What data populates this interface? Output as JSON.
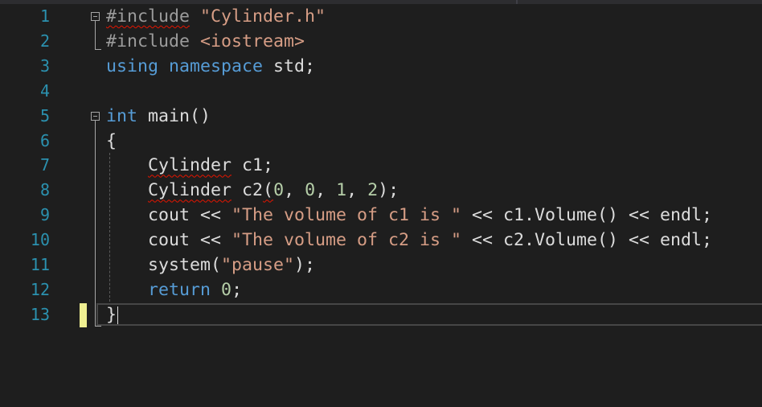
{
  "editor": {
    "colors": {
      "line_number": "#2b91af",
      "preprocessor": "#9b9b9b",
      "string": "#d69d85",
      "keyword": "#569cd6",
      "number": "#b5cea8",
      "text": "#dcdcdc"
    },
    "lines": [
      {
        "number": "1",
        "tokens": [
          {
            "t": "pp",
            "v": "#include",
            "err": true
          },
          {
            "t": "txt",
            "v": " "
          },
          {
            "t": "str",
            "v": "\"Cylinder.h\""
          }
        ]
      },
      {
        "number": "2",
        "tokens": [
          {
            "t": "pp",
            "v": "#include"
          },
          {
            "t": "txt",
            "v": " "
          },
          {
            "t": "str",
            "v": "<iostream>"
          }
        ]
      },
      {
        "number": "3",
        "tokens": [
          {
            "t": "kw",
            "v": "using"
          },
          {
            "t": "txt",
            "v": " "
          },
          {
            "t": "kw",
            "v": "namespace"
          },
          {
            "t": "txt",
            "v": " std;"
          }
        ]
      },
      {
        "number": "4",
        "tokens": []
      },
      {
        "number": "5",
        "tokens": [
          {
            "t": "kw",
            "v": "int"
          },
          {
            "t": "txt",
            "v": " main()"
          }
        ]
      },
      {
        "number": "6",
        "tokens": [
          {
            "t": "txt",
            "v": "{"
          }
        ]
      },
      {
        "number": "7",
        "tokens": [
          {
            "t": "txt",
            "v": "    "
          },
          {
            "t": "txt",
            "v": "Cylinder",
            "err": true
          },
          {
            "t": "txt",
            "v": " c1;"
          }
        ]
      },
      {
        "number": "8",
        "tokens": [
          {
            "t": "txt",
            "v": "    "
          },
          {
            "t": "txt",
            "v": "Cylinder",
            "err": true
          },
          {
            "t": "txt",
            "v": " c2"
          },
          {
            "t": "txt",
            "v": "(",
            "err": true
          },
          {
            "t": "num",
            "v": "0"
          },
          {
            "t": "txt",
            "v": ", "
          },
          {
            "t": "num",
            "v": "0"
          },
          {
            "t": "txt",
            "v": ", "
          },
          {
            "t": "num",
            "v": "1"
          },
          {
            "t": "txt",
            "v": ", "
          },
          {
            "t": "num",
            "v": "2"
          },
          {
            "t": "txt",
            "v": ");"
          }
        ]
      },
      {
        "number": "9",
        "tokens": [
          {
            "t": "txt",
            "v": "    cout << "
          },
          {
            "t": "str",
            "v": "\"The volume of c1 is \""
          },
          {
            "t": "txt",
            "v": " << c1.Volume() << endl;"
          }
        ]
      },
      {
        "number": "10",
        "tokens": [
          {
            "t": "txt",
            "v": "    cout << "
          },
          {
            "t": "str",
            "v": "\"The volume of c2 is \""
          },
          {
            "t": "txt",
            "v": " << c2.Volume() << endl;"
          }
        ]
      },
      {
        "number": "11",
        "tokens": [
          {
            "t": "txt",
            "v": "    system("
          },
          {
            "t": "str",
            "v": "\"pause\""
          },
          {
            "t": "txt",
            "v": ");"
          }
        ]
      },
      {
        "number": "12",
        "tokens": [
          {
            "t": "txt",
            "v": "    "
          },
          {
            "t": "kw",
            "v": "return"
          },
          {
            "t": "txt",
            "v": " "
          },
          {
            "t": "num",
            "v": "0"
          },
          {
            "t": "txt",
            "v": ";"
          }
        ]
      },
      {
        "number": "13",
        "tokens": [
          {
            "t": "txt",
            "v": "}"
          }
        ]
      }
    ]
  }
}
